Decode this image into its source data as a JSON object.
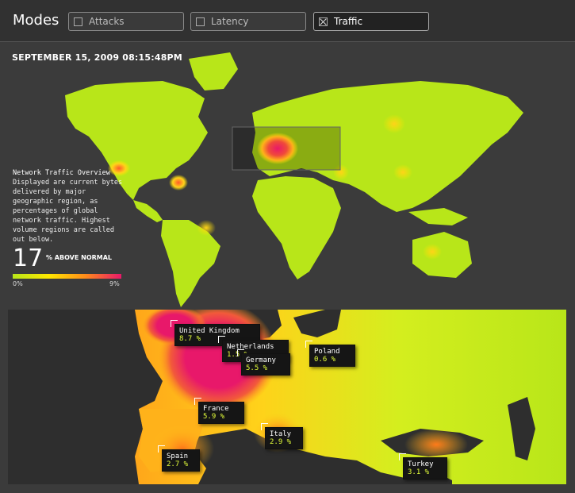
{
  "header": {
    "title": "Modes",
    "modes": [
      {
        "label": "Attacks",
        "checked": false
      },
      {
        "label": "Latency",
        "checked": false
      },
      {
        "label": "Traffic",
        "checked": true
      }
    ]
  },
  "timestamp": "SEPTEMBER 15, 2009 08:15:48PM",
  "overview": {
    "title": "Network Traffic Overview",
    "description": "Displayed are current bytes delivered by major geographic region, as percentages of global network traffic. Highest volume regions are called out below."
  },
  "above_normal": {
    "value": "17",
    "label": "% ABOVE NORMAL"
  },
  "scale": {
    "min": "0%",
    "max": "9%",
    "colors": [
      "#b8e619",
      "#ffe800",
      "#ff8c1a",
      "#e8186a"
    ]
  },
  "callouts": [
    {
      "country": "United Kingdom",
      "value": "8.7 %"
    },
    {
      "country": "Netherlands",
      "value": "1.5 %"
    },
    {
      "country": "Germany",
      "value": "5.5 %"
    },
    {
      "country": "Poland",
      "value": "0.6 %"
    },
    {
      "country": "France",
      "value": "5.9 %"
    },
    {
      "country": "Italy",
      "value": "2.9 %"
    },
    {
      "country": "Spain",
      "value": "2.7 %"
    },
    {
      "country": "Turkey",
      "value": "3.1 %"
    }
  ]
}
